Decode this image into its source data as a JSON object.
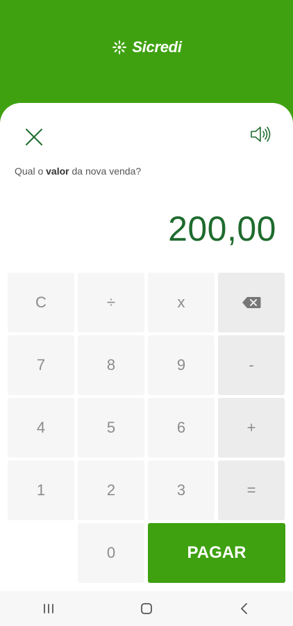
{
  "header": {
    "brand": "Sicredi",
    "logo_icon": "sicredi-logo-icon"
  },
  "toolbar": {
    "close_icon": "close-icon",
    "speaker_icon": "speaker-icon"
  },
  "prompt": {
    "before": "Qual o ",
    "highlight": "valor",
    "after": " da nova venda?"
  },
  "amount": "200,00",
  "keypad": {
    "row1": [
      "C",
      "÷",
      "x"
    ],
    "backspace_icon": "backspace-icon",
    "row2": [
      "7",
      "8",
      "9",
      "-"
    ],
    "row3": [
      "4",
      "5",
      "6",
      "+"
    ],
    "row4": [
      "1",
      "2",
      "3",
      "="
    ],
    "zero": "0",
    "pay_label": "PAGAR"
  },
  "navbar": {
    "recents_icon": "recents-icon",
    "home_icon": "home-icon",
    "back_icon": "back-icon"
  },
  "colors": {
    "brand_green": "#3fa110",
    "amount_green": "#1e6b2e"
  }
}
